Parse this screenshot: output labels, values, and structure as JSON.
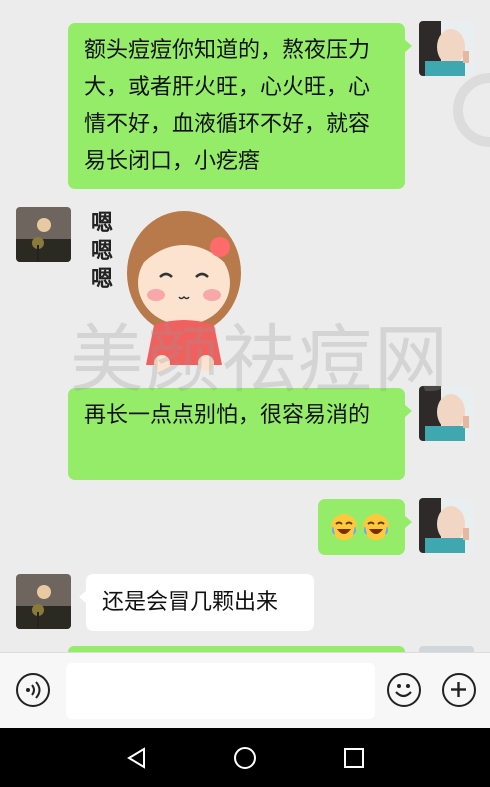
{
  "watermark": "美颜祛痘网",
  "messages": [
    {
      "side": "me",
      "text": "额头痘痘你知道的，熬夜压力大，或者肝火旺，心火旺，心情不好，血液循环不好，就容易长闭口，小疙瘩"
    },
    {
      "side": "other",
      "type": "sticker",
      "sticker_text": [
        "嗯",
        "嗯",
        "嗯"
      ],
      "sticker_badge": "嗯"
    },
    {
      "side": "me",
      "text": "再长一点点别怕，很容易消的"
    },
    {
      "side": "me",
      "type": "emoji",
      "emojis": [
        "crying-laughing-icon",
        "crying-laughing-icon"
      ]
    },
    {
      "side": "other",
      "text": "还是会冒几颗出来"
    }
  ],
  "input": {
    "placeholder": ""
  },
  "colors": {
    "my_bubble": "#95ec69",
    "other_bubble": "#ffffff",
    "chat_bg": "#ececec"
  }
}
